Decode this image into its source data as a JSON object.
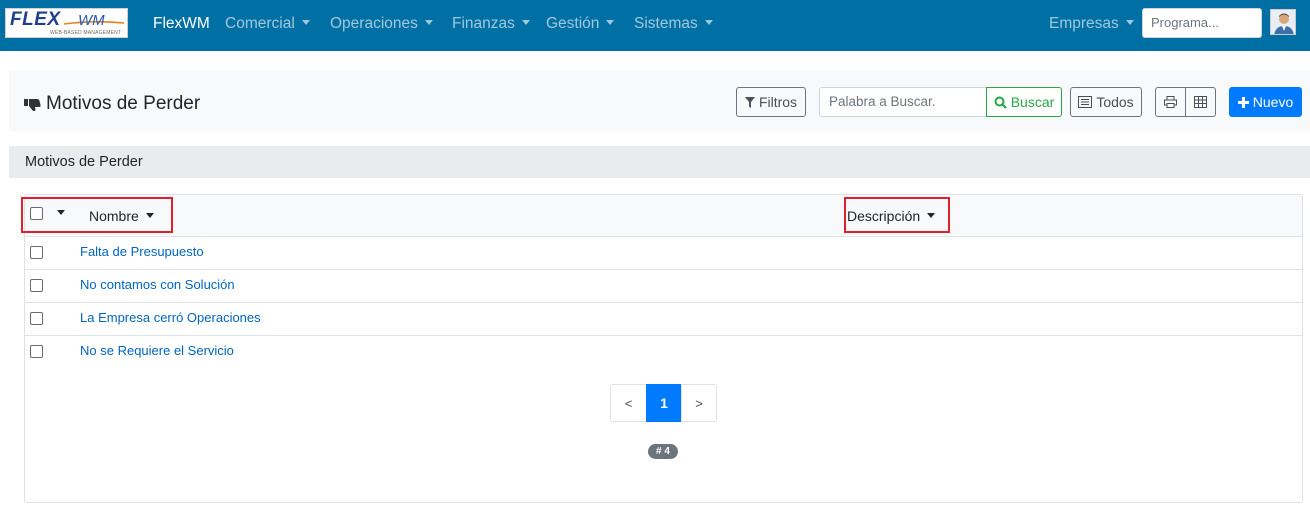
{
  "navbar": {
    "logo": {
      "main": "FLEX",
      "suffix": "WM",
      "tagline": "WEB-BASED MANAGEMENT"
    },
    "brand": "FlexWM",
    "menu": [
      "Comercial",
      "Operaciones",
      "Finanzas",
      "Gestión",
      "Sistemas"
    ],
    "empresas": "Empresas",
    "program_placeholder": "Programa..."
  },
  "header": {
    "title": "Motivos de Perder",
    "filters_label": "Filtros",
    "search_placeholder": "Palabra a Buscar.",
    "search_label": "Buscar",
    "all_label": "Todos",
    "new_label": "Nuevo"
  },
  "section": {
    "title": "Motivos de Perder"
  },
  "table": {
    "columns": [
      "Nombre",
      "Descripción"
    ],
    "rows": [
      {
        "nombre": "Falta de Presupuesto",
        "descripcion": ""
      },
      {
        "nombre": "No contamos con Solución",
        "descripcion": ""
      },
      {
        "nombre": "La Empresa cerró Operaciones",
        "descripcion": ""
      },
      {
        "nombre": "No se Requiere el Servicio",
        "descripcion": ""
      }
    ]
  },
  "pagination": {
    "prev": "<",
    "current": "1",
    "next": ">"
  },
  "count_badge": "# 4",
  "colors": {
    "navbar": "#006fa4",
    "primary": "#007bff",
    "success": "#28a745",
    "highlight": "#e0202a",
    "link": "#0066c0"
  }
}
